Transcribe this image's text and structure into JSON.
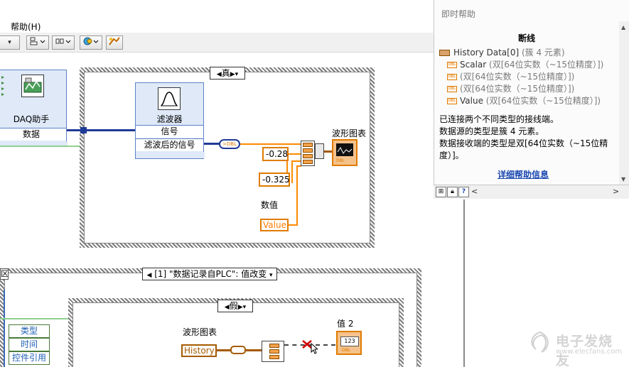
{
  "menu": {
    "help": "帮助(H)"
  },
  "toolbar": {
    "buttons": [
      "align-icon",
      "distribute-icon",
      "resize-icon",
      "reorder-icon",
      "cleanup-icon"
    ]
  },
  "case_top": {
    "selector": "真",
    "daq": {
      "title": "DAQ助手",
      "output": "数据"
    },
    "filter": {
      "title": "滤波器",
      "input": "信号",
      "output": "滤波后的信号"
    },
    "constants": [
      "-0.28",
      "-0.325"
    ],
    "numeric_label": "数值",
    "numeric_terminal": "Value",
    "graph_label": "波形图表"
  },
  "case_bottom": {
    "event_label": "[1] \"数据记录自PLC\": 值改变",
    "selector": "假",
    "event_items": [
      "类型",
      "时间",
      "控件引用"
    ],
    "graph_label": "波形图表",
    "history_terminal": "History",
    "indicator_label": "值 2",
    "indicator_value": "123",
    "left_fragment": "区"
  },
  "help": {
    "title": "即时帮助",
    "heading": "断线",
    "cluster": "History Data[0]",
    "cluster_type": "(簇 4 元素)",
    "elements": [
      {
        "name": "Scalar",
        "type": "(双[64位实数（~15位精度）])"
      },
      {
        "name": "",
        "type": "(双[64位实数（~15位精度）])"
      },
      {
        "name": "",
        "type": "(双[64位实数（~15位精度）])"
      },
      {
        "name": "Value",
        "type": "(双[64位实数（~15位精度）])"
      }
    ],
    "desc_1": "已连接两个不同类型的接线端。",
    "desc_2": "数据源的类型是簇 4 元素。",
    "desc_3": "数据接收端的类型是双[64位实数（~15位精度）]。",
    "link": "详细帮助信息"
  },
  "watermark": {
    "cn": "电子发烧友",
    "url": "www.elecfans.com"
  },
  "colors": {
    "numeric": "#ff7d00",
    "wire_cluster": "#1f3b96",
    "link": "#1a47b0"
  }
}
